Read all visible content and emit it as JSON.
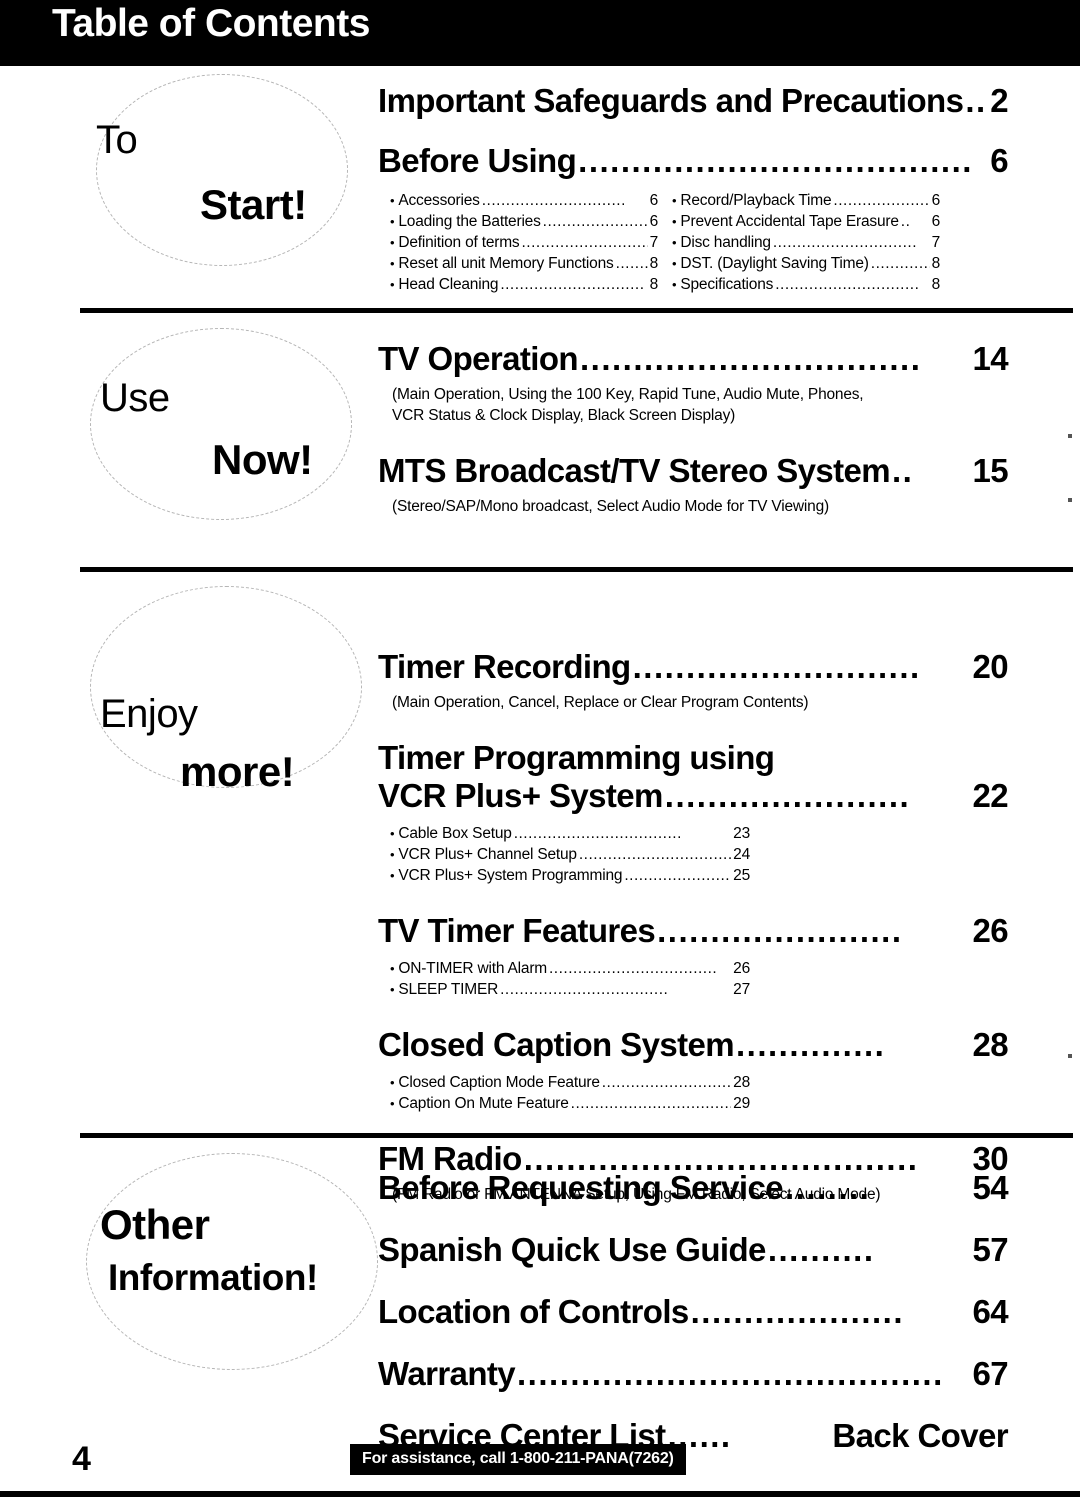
{
  "header": {
    "title": "Table of Contents"
  },
  "footer": {
    "page_number": "4",
    "assistance_text": "For assistance, call 1-800-211-PANA(7262)"
  },
  "sections": [
    {
      "tab_line1": "To",
      "tab_line2": "Start!",
      "entries": [
        {
          "title": "Important Safeguards and Precautions",
          "page": "2",
          "dots": "...",
          "desc": null,
          "subs_left": [],
          "subs_right": []
        },
        {
          "title": "Before Using",
          "page": "6",
          "dots": ".....................................",
          "desc": null,
          "subs_left": [
            {
              "label": "Accessories",
              "page": "6"
            },
            {
              "label": "Loading the Batteries",
              "page": "6"
            },
            {
              "label": "Definition of terms",
              "page": "7"
            },
            {
              "label": "Reset all unit Memory Functions",
              "page": "8"
            },
            {
              "label": "Head Cleaning",
              "page": "8"
            }
          ],
          "subs_right": [
            {
              "label": "Record/Playback Time",
              "page": "6"
            },
            {
              "label": "Prevent Accidental Tape Erasure",
              "page": "6"
            },
            {
              "label": "Disc handling",
              "page": "7"
            },
            {
              "label": "DST. (Daylight Saving Time)",
              "page": "8"
            },
            {
              "label": "Specifications",
              "page": "8"
            }
          ]
        }
      ]
    },
    {
      "tab_line1": "Use",
      "tab_line2": "Now!",
      "entries": [
        {
          "title": "TV Operation",
          "page": "14",
          "dots": "................................",
          "desc": "(Main Operation, Using the 100 Key, Rapid Tune, Audio Mute, Phones,\nVCR Status & Clock Display, Black Screen Display)",
          "subs_left": [],
          "subs_right": []
        },
        {
          "title": "MTS Broadcast/TV Stereo System",
          "page": "15",
          "dots": "..",
          "desc": "(Stereo/SAP/Mono broadcast, Select Audio Mode for TV Viewing)",
          "subs_left": [],
          "subs_right": []
        }
      ]
    },
    {
      "tab_line1": "Enjoy",
      "tab_line2": "more!",
      "entries": [
        {
          "title": "Timer Recording",
          "page": "20",
          "dots": "...........................",
          "desc": "(Main Operation, Cancel, Replace or Clear Program Contents)",
          "subs_left": [],
          "subs_right": []
        },
        {
          "title_line_a": "Timer Programming using",
          "title": "VCR Plus+ System",
          "page": "22",
          "dots": ".......................",
          "desc": null,
          "subs_left": [
            {
              "label": "Cable Box Setup",
              "page": "23"
            },
            {
              "label": "VCR Plus+ Channel Setup",
              "page": "24"
            },
            {
              "label": "VCR Plus+ System Programming",
              "page": "25"
            }
          ],
          "subs_right": []
        },
        {
          "title": "TV Timer Features",
          "page": "26",
          "dots": ".......................",
          "desc": null,
          "subs_left": [
            {
              "label": "ON-TIMER with Alarm",
              "page": "26"
            },
            {
              "label": "SLEEP TIMER",
              "page": "27"
            }
          ],
          "subs_right": []
        },
        {
          "title": "Closed Caption System",
          "page": "28",
          "dots": "..............",
          "desc": null,
          "subs_left": [
            {
              "label": "Closed Caption Mode Feature",
              "page": "28"
            },
            {
              "label": "Caption On Mute Feature",
              "page": "29"
            }
          ],
          "subs_right": []
        },
        {
          "title": "FM Radio",
          "page": "30",
          "dots": ".....................................",
          "desc": "(FM Radio or FM ANTENNA Setup, Using FM Radio, Select Audio Mode)",
          "subs_left": [],
          "subs_right": []
        }
      ]
    },
    {
      "tab_line1": "Other",
      "tab_line2": "Information!",
      "entries": [
        {
          "title": "Before Requesting Service",
          "page": "54",
          "dots": "........",
          "desc": null,
          "subs_left": [],
          "subs_right": []
        },
        {
          "title": "Spanish Quick Use Guide",
          "page": "57",
          "dots": "..........",
          "desc": null,
          "subs_left": [],
          "subs_right": []
        },
        {
          "title": "Location of Controls",
          "page": "64",
          "dots": "....................",
          "desc": null,
          "subs_left": [],
          "subs_right": []
        },
        {
          "title": "Warranty",
          "page": "67",
          "dots": "........................................",
          "desc": null,
          "subs_left": [],
          "subs_right": []
        },
        {
          "title": "Service Center List",
          "page": "Back Cover",
          "dots": "......",
          "desc": null,
          "subs_left": [],
          "subs_right": []
        }
      ]
    }
  ]
}
